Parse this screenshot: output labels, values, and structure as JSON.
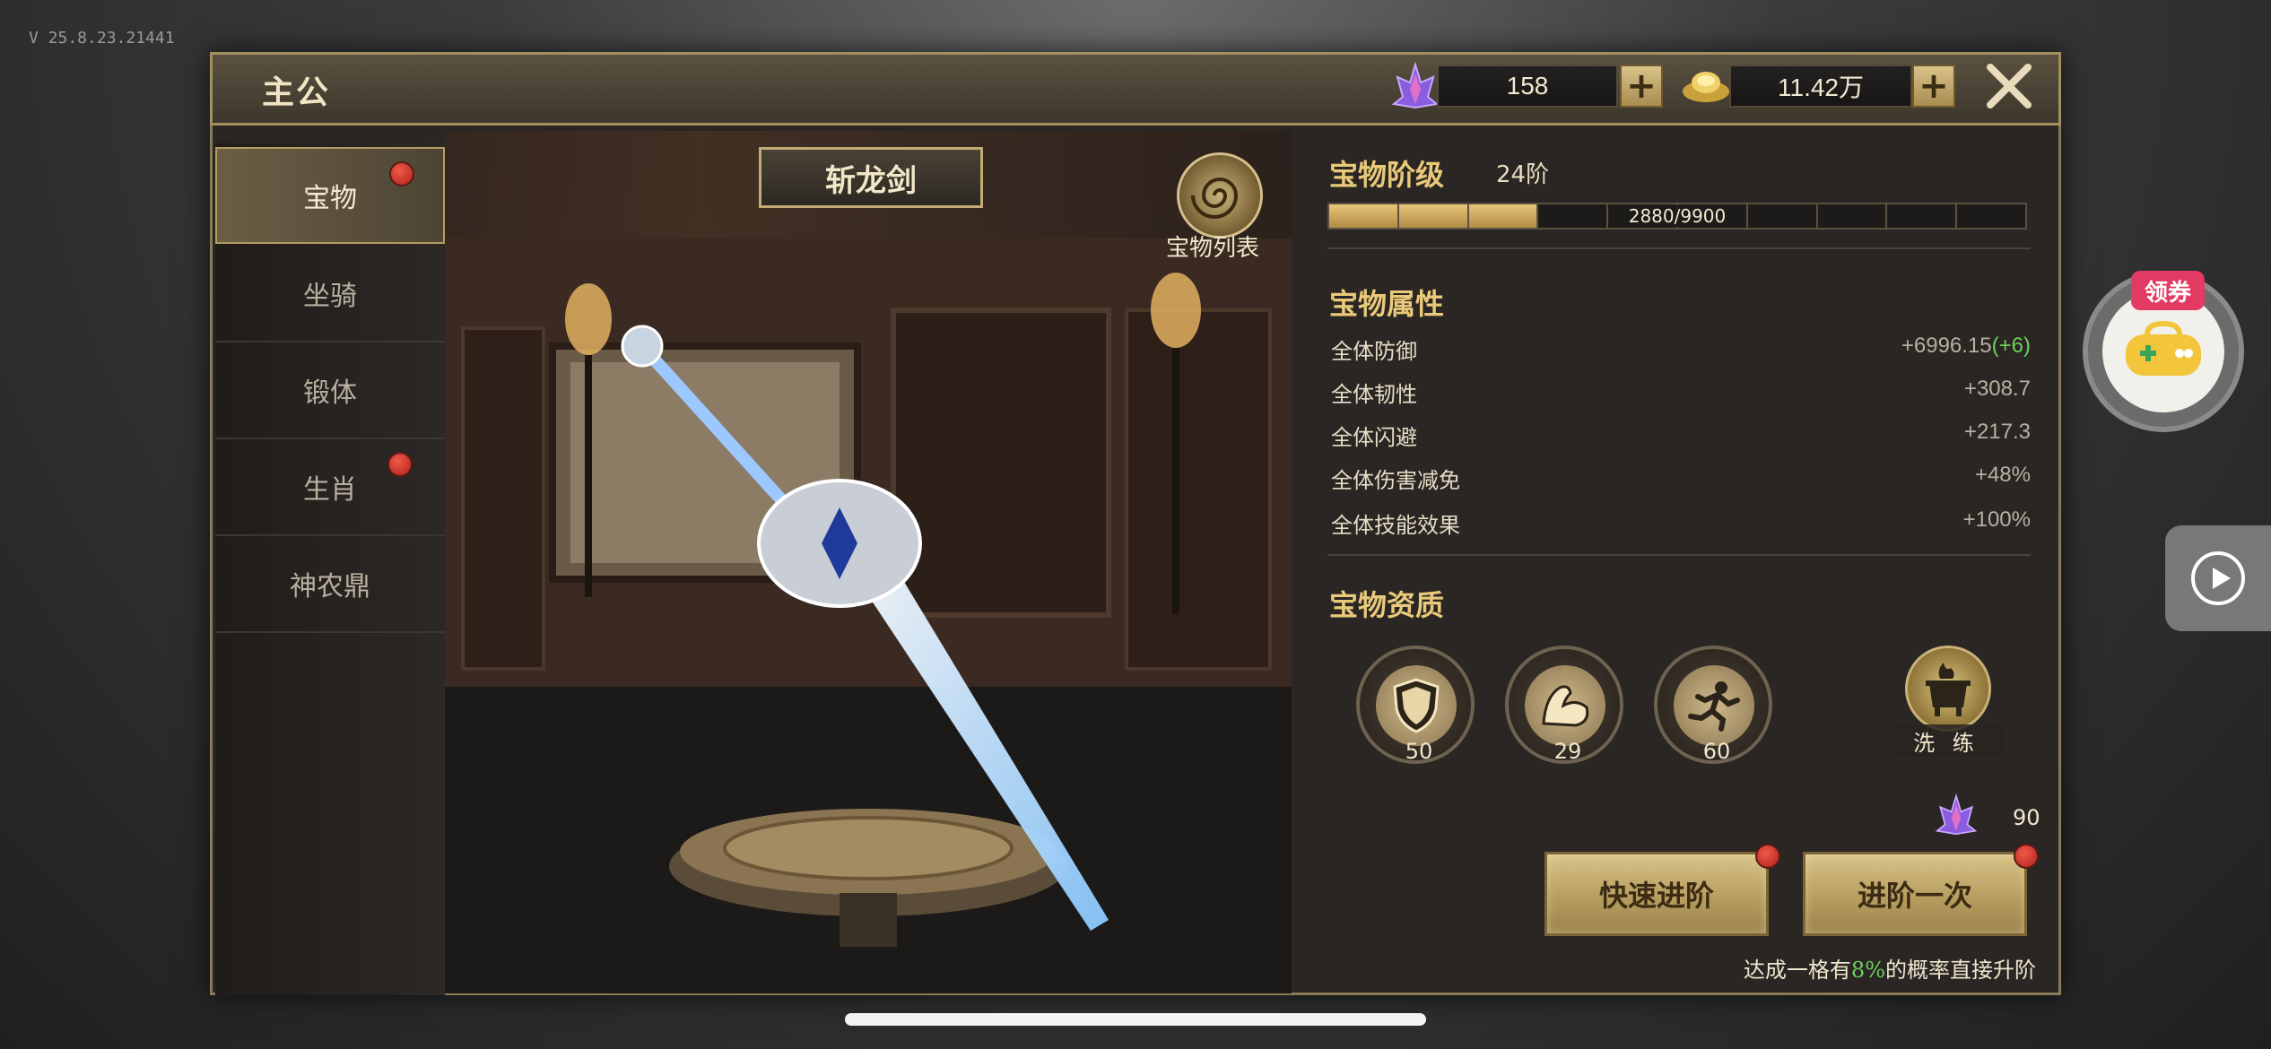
{
  "version": "V 25.8.23.21441",
  "header": {
    "title": "主公",
    "gems": "158",
    "gold": "11.42万"
  },
  "tabs": [
    {
      "label": "宝物",
      "active": true,
      "badge": true
    },
    {
      "label": "坐骑",
      "active": false,
      "badge": false
    },
    {
      "label": "锻体",
      "active": false,
      "badge": false
    },
    {
      "label": "生肖",
      "active": false,
      "badge": true
    },
    {
      "label": "神农鼎",
      "active": false,
      "badge": false
    }
  ],
  "treasure": {
    "name": "斩龙剑",
    "list_label": "宝物列表"
  },
  "stage": {
    "title": "宝物阶级",
    "value": "24阶",
    "progress_text": "2880/9900",
    "progress_fraction": 0.2909
  },
  "attributes": {
    "title": "宝物属性",
    "items": [
      {
        "name": "全体防御",
        "value": "+6996.15",
        "extra": "(+6)"
      },
      {
        "name": "全体韧性",
        "value": "+308.7",
        "extra": ""
      },
      {
        "name": "全体闪避",
        "value": "+217.3",
        "extra": ""
      },
      {
        "name": "全体伤害减免",
        "value": "+48%",
        "extra": ""
      },
      {
        "name": "全体技能效果",
        "value": "+100%",
        "extra": ""
      }
    ]
  },
  "qualities": {
    "title": "宝物资质",
    "items": [
      {
        "icon": "shield-icon",
        "value": "50"
      },
      {
        "icon": "muscle-icon",
        "value": "29"
      },
      {
        "icon": "running-icon",
        "value": "60"
      }
    ],
    "wash_label": "洗 练"
  },
  "cost": "90",
  "buttons": {
    "quick": "快速进阶",
    "once": "进阶一次"
  },
  "hint": {
    "prefix": "达成一格有",
    "pct": "8%",
    "suffix": "的概率直接升阶"
  },
  "side": {
    "coupon_tag": "领券"
  },
  "colors": {
    "accent_gold": "#e9c97a",
    "bonus_green": "#6ccf5a",
    "badge_red": "#d0342a"
  }
}
